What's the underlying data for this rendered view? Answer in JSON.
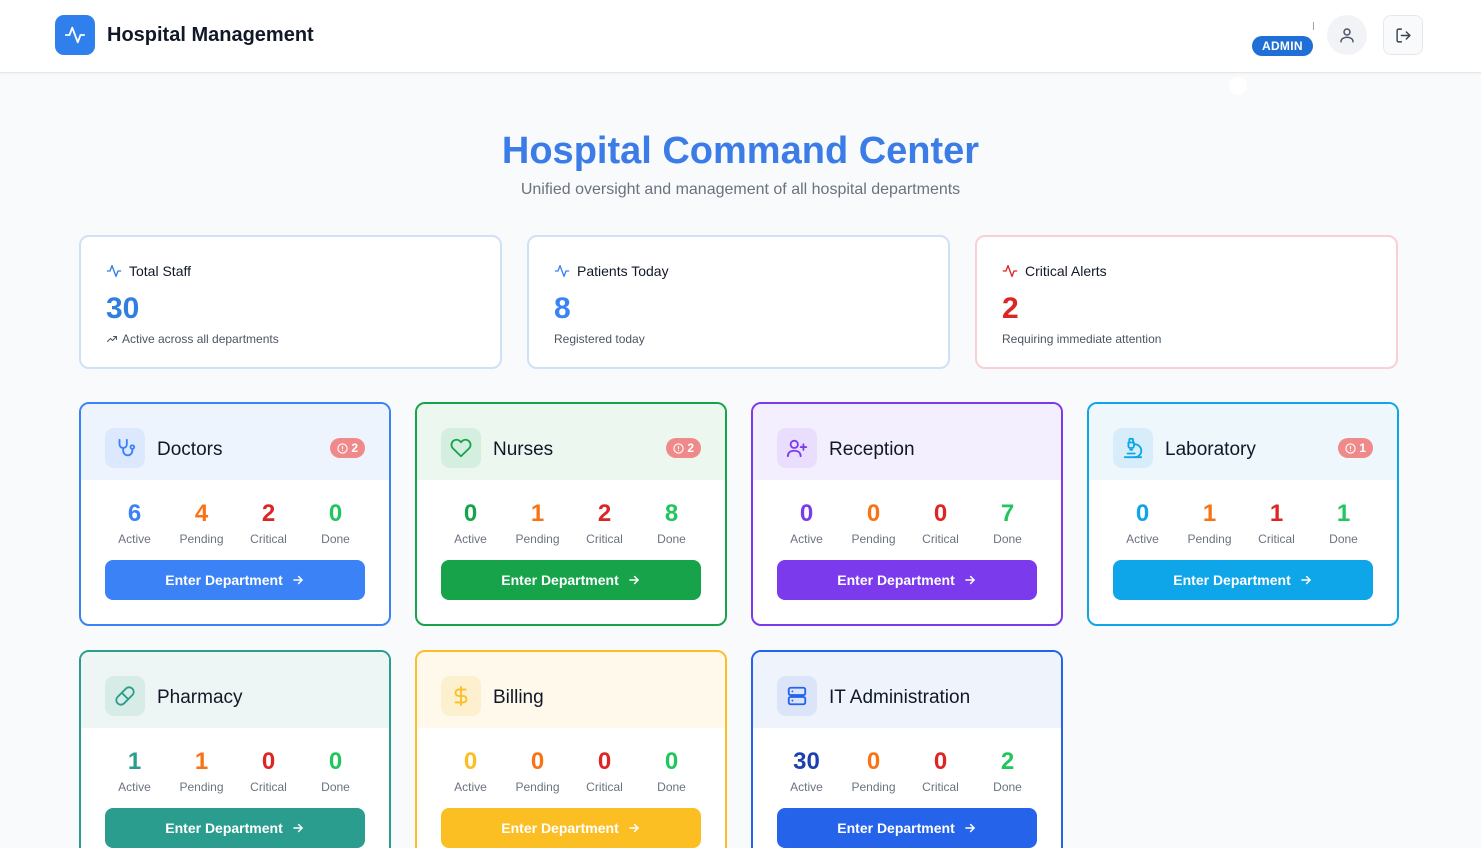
{
  "header": {
    "app_title": "Hospital Management",
    "role_badge": "ADMIN",
    "logo_icon": "activity-icon",
    "user_icon": "user-icon",
    "logout_icon": "logout-icon"
  },
  "hero": {
    "title": "Hospital Command Center",
    "subtitle": "Unified oversight and management of all hospital departments"
  },
  "stats": [
    {
      "label": "Total Staff",
      "value": "30",
      "note": "Active across all departments",
      "icon": "activity-icon",
      "note_icon": "trending-up-icon",
      "color": "#2f7fe0"
    },
    {
      "label": "Patients Today",
      "value": "8",
      "note": "Registered today",
      "icon": "activity-icon",
      "color": "#3b82f6"
    },
    {
      "label": "Critical Alerts",
      "value": "2",
      "note": "Requiring immediate attention",
      "icon": "activity-icon",
      "color": "#dc2626"
    }
  ],
  "metric_labels": {
    "active": "Active",
    "pending": "Pending",
    "critical": "Critical",
    "done": "Done"
  },
  "departments": [
    {
      "name": "Doctors",
      "icon": "stethoscope-icon",
      "alerts": "2",
      "active": "6",
      "pending": "4",
      "critical": "2",
      "done": "0",
      "button": "Enter Department",
      "accent": "#3b82f6"
    },
    {
      "name": "Nurses",
      "icon": "heart-icon",
      "alerts": "2",
      "active": "0",
      "pending": "1",
      "critical": "2",
      "done": "8",
      "button": "Enter Department",
      "accent": "#16a34a"
    },
    {
      "name": "Reception",
      "icon": "user-plus-icon",
      "active": "0",
      "pending": "0",
      "critical": "0",
      "done": "7",
      "button": "Enter Department",
      "accent": "#7c3aed"
    },
    {
      "name": "Laboratory",
      "icon": "microscope-icon",
      "alerts": "1",
      "active": "0",
      "pending": "1",
      "critical": "1",
      "done": "1",
      "button": "Enter Department",
      "accent": "#0ea5e9"
    },
    {
      "name": "Pharmacy",
      "icon": "pill-icon",
      "active": "1",
      "pending": "1",
      "critical": "0",
      "done": "0",
      "button": "Enter Department",
      "accent": "#2a9d8f"
    },
    {
      "name": "Billing",
      "icon": "dollar-icon",
      "active": "0",
      "pending": "0",
      "critical": "0",
      "done": "0",
      "button": "Enter Department",
      "accent": "#fbbf24"
    },
    {
      "name": "IT Administration",
      "icon": "server-icon",
      "active": "30",
      "pending": "0",
      "critical": "0",
      "done": "2",
      "button": "Enter Department",
      "accent": "#2563eb"
    }
  ]
}
